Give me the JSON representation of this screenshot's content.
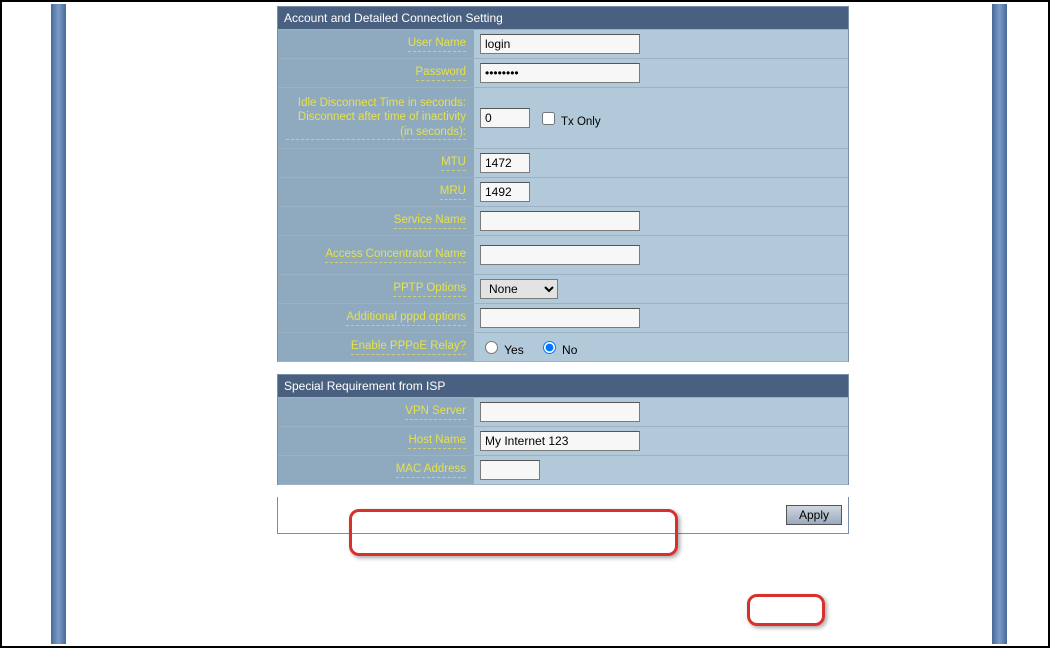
{
  "sections": {
    "account": {
      "title": "Account and Detailed Connection Setting",
      "user_name_label": "User Name",
      "user_name_value": "login",
      "password_label": "Password",
      "password_value": "••••••••",
      "idle_label": "Idle Disconnect Time in seconds: Disconnect after time of inactivity (in seconds):",
      "idle_value": "0",
      "tx_only_label": "Tx Only",
      "mtu_label": "MTU",
      "mtu_value": "1472",
      "mru_label": "MRU",
      "mru_value": "1492",
      "service_name_label": "Service Name",
      "service_name_value": "",
      "access_concentrator_label": "Access Concentrator Name",
      "access_concentrator_value": "",
      "pptp_options_label": "PPTP Options",
      "pptp_options_value": "None",
      "additional_pppd_label": "Additional pppd options",
      "additional_pppd_value": "",
      "pppoe_relay_label": "Enable PPPoE Relay?",
      "yes_label": "Yes",
      "no_label": "No"
    },
    "isp": {
      "title": "Special Requirement from ISP",
      "vpn_server_label": "VPN Server",
      "vpn_server_value": "",
      "host_name_label": "Host Name",
      "host_name_value": "My Internet 123",
      "mac_address_label": "MAC Address",
      "mac_address_value": ""
    }
  },
  "footer": {
    "apply_label": "Apply"
  }
}
